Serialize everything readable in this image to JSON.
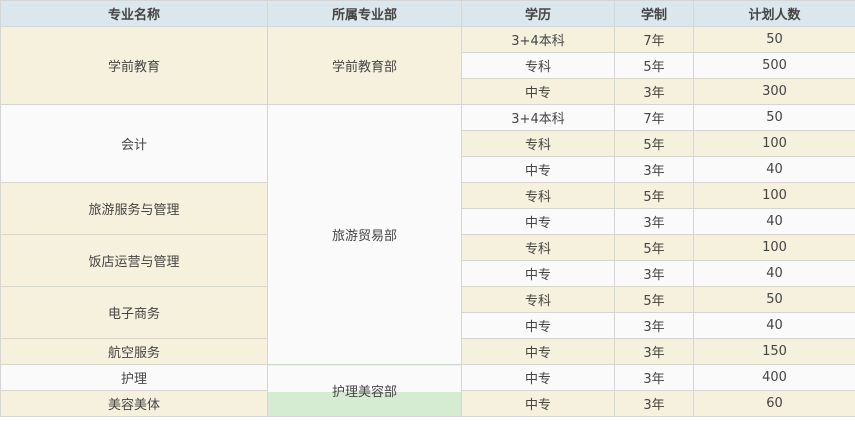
{
  "headers": [
    "专业名称",
    "所属专业部",
    "学历",
    "学制",
    "计划人数"
  ],
  "majors": [
    "学前教育",
    "会计",
    "旅游服务与管理",
    "饭店运营与管理",
    "电子商务",
    "航空服务",
    "护理",
    "美容美体"
  ],
  "departments": [
    "学前教育部",
    "旅游贸易部",
    "护理美容部"
  ],
  "rows": [
    {
      "edu": "3+4本科",
      "years": "7年",
      "count": "50"
    },
    {
      "edu": "专科",
      "years": "5年",
      "count": "500"
    },
    {
      "edu": "中专",
      "years": "3年",
      "count": "300"
    },
    {
      "edu": "3+4本科",
      "years": "7年",
      "count": "50"
    },
    {
      "edu": "专科",
      "years": "5年",
      "count": "100"
    },
    {
      "edu": "中专",
      "years": "3年",
      "count": "40"
    },
    {
      "edu": "专科",
      "years": "5年",
      "count": "100"
    },
    {
      "edu": "中专",
      "years": "3年",
      "count": "40"
    },
    {
      "edu": "专科",
      "years": "5年",
      "count": "100"
    },
    {
      "edu": "中专",
      "years": "3年",
      "count": "40"
    },
    {
      "edu": "专科",
      "years": "5年",
      "count": "50"
    },
    {
      "edu": "中专",
      "years": "3年",
      "count": "40"
    },
    {
      "edu": "中专",
      "years": "3年",
      "count": "150"
    },
    {
      "edu": "中专",
      "years": "3年",
      "count": "400"
    },
    {
      "edu": "中专",
      "years": "3年",
      "count": "60"
    }
  ]
}
